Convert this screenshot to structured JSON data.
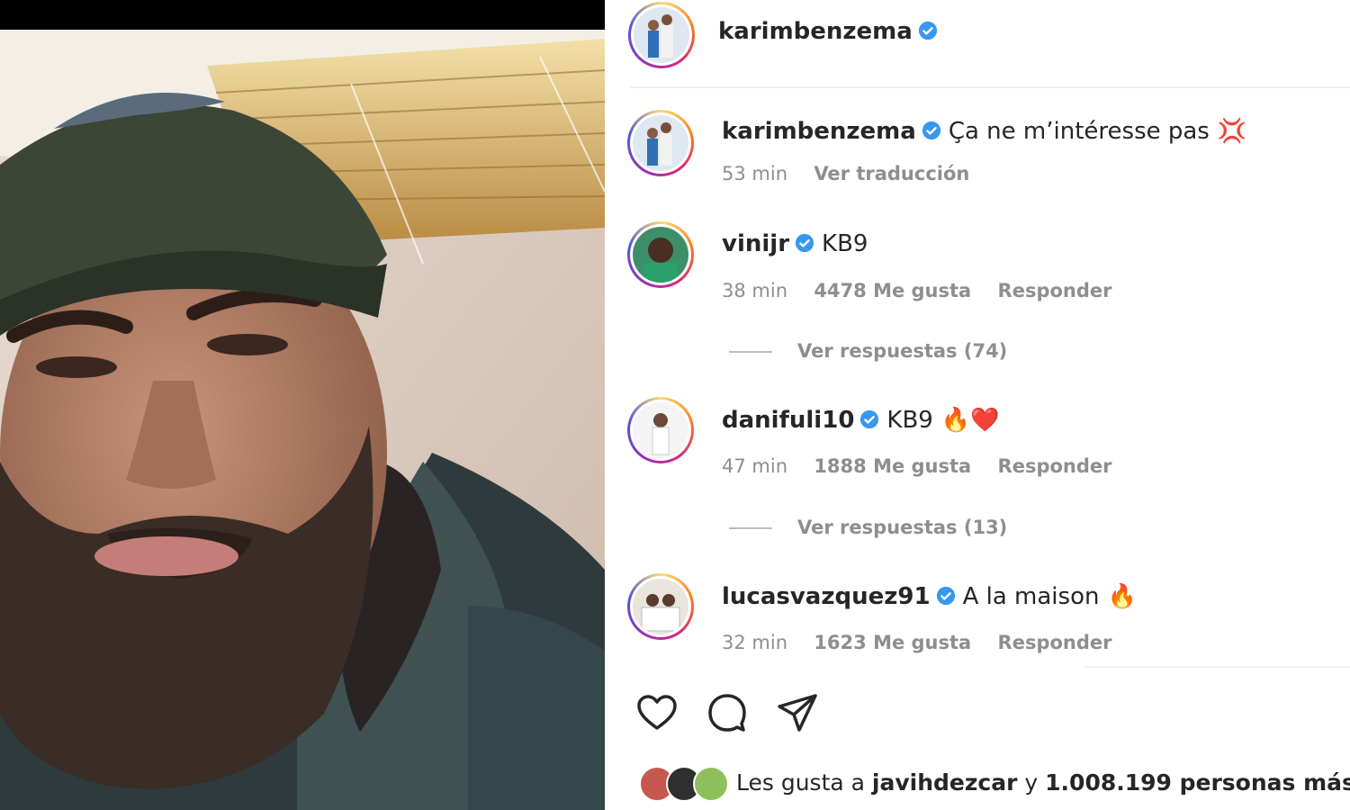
{
  "post": {
    "author": "karimbenzema"
  },
  "caption": {
    "username": "karimbenzema",
    "text": "Ça ne m’intéresse pas",
    "emoji": "💢",
    "time": "53 min",
    "translate": "Ver traducción"
  },
  "comments": [
    {
      "username": "vinijr",
      "text": "KB9",
      "emoji": "",
      "time": "38 min",
      "likes": "4478 Me gusta",
      "reply": "Responder",
      "view_replies": "Ver respuestas (74)"
    },
    {
      "username": "danifuli10",
      "text": "KB9",
      "emoji": "🔥❤️",
      "time": "47 min",
      "likes": "1888 Me gusta",
      "reply": "Responder",
      "view_replies": "Ver respuestas (13)"
    },
    {
      "username": "lucasvazquez91",
      "text": "A la maison",
      "emoji": "🔥",
      "time": "32 min",
      "likes": "1623 Me gusta",
      "reply": "Responder"
    }
  ],
  "actions": {
    "like_icon": "heart-icon",
    "comment_icon": "comment-icon",
    "share_icon": "send-icon"
  },
  "likes_line": {
    "prefix": "Les gusta a",
    "user": "javihdezcar",
    "connector": "y",
    "count": "1.008.199 personas más"
  },
  "colors": {
    "verified": "#3897f0",
    "muted": "#8e8e8e",
    "text": "#262626"
  }
}
